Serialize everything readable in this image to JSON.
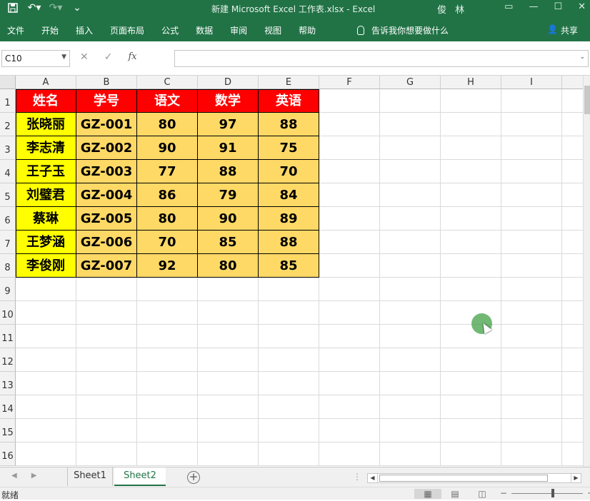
{
  "titlebar": {
    "title": "新建 Microsoft Excel 工作表.xlsx  -  Excel",
    "user": "俊 林",
    "save_icon": "save-icon",
    "undo_icon": "undo-icon",
    "redo_icon": "redo-icon",
    "customize_icon": "customize-qat-icon"
  },
  "ribbon": {
    "tabs": [
      "文件",
      "开始",
      "插入",
      "页面布局",
      "公式",
      "数据",
      "审阅",
      "视图",
      "帮助"
    ],
    "tell_me": "告诉我你想要做什么",
    "share": "共享"
  },
  "formula_bar": {
    "name_box": "C10",
    "cancel": "✕",
    "enter": "✓",
    "fx": "fx",
    "content": ""
  },
  "grid": {
    "columns": [
      "A",
      "B",
      "C",
      "D",
      "E",
      "F",
      "G",
      "H",
      "I"
    ],
    "rows": [
      "1",
      "2",
      "3",
      "4",
      "5",
      "6",
      "7",
      "8",
      "9",
      "10",
      "11",
      "12",
      "13",
      "14",
      "15",
      "16"
    ],
    "header": [
      "姓名",
      "学号",
      "语文",
      "数学",
      "英语"
    ],
    "data": [
      [
        "张晓丽",
        "GZ-001",
        "80",
        "97",
        "88"
      ],
      [
        "李志清",
        "GZ-002",
        "90",
        "91",
        "75"
      ],
      [
        "王子玉",
        "GZ-003",
        "77",
        "88",
        "70"
      ],
      [
        "刘璧君",
        "GZ-004",
        "86",
        "79",
        "84"
      ],
      [
        "蔡琳",
        "GZ-005",
        "80",
        "90",
        "89"
      ],
      [
        "王梦涵",
        "GZ-006",
        "70",
        "85",
        "88"
      ],
      [
        "李俊刚",
        "GZ-007",
        "92",
        "80",
        "85"
      ]
    ]
  },
  "sheets": {
    "tabs": [
      "Sheet1",
      "Sheet2"
    ],
    "active": "Sheet2",
    "add": "+"
  },
  "status": {
    "ready": "就绪",
    "zoom_minus": "−",
    "zoom_plus": "+"
  },
  "colors": {
    "excel_green": "#217346",
    "header_red": "#ff0000",
    "name_yellow": "#ffff00",
    "value_gold": "#ffd966"
  }
}
